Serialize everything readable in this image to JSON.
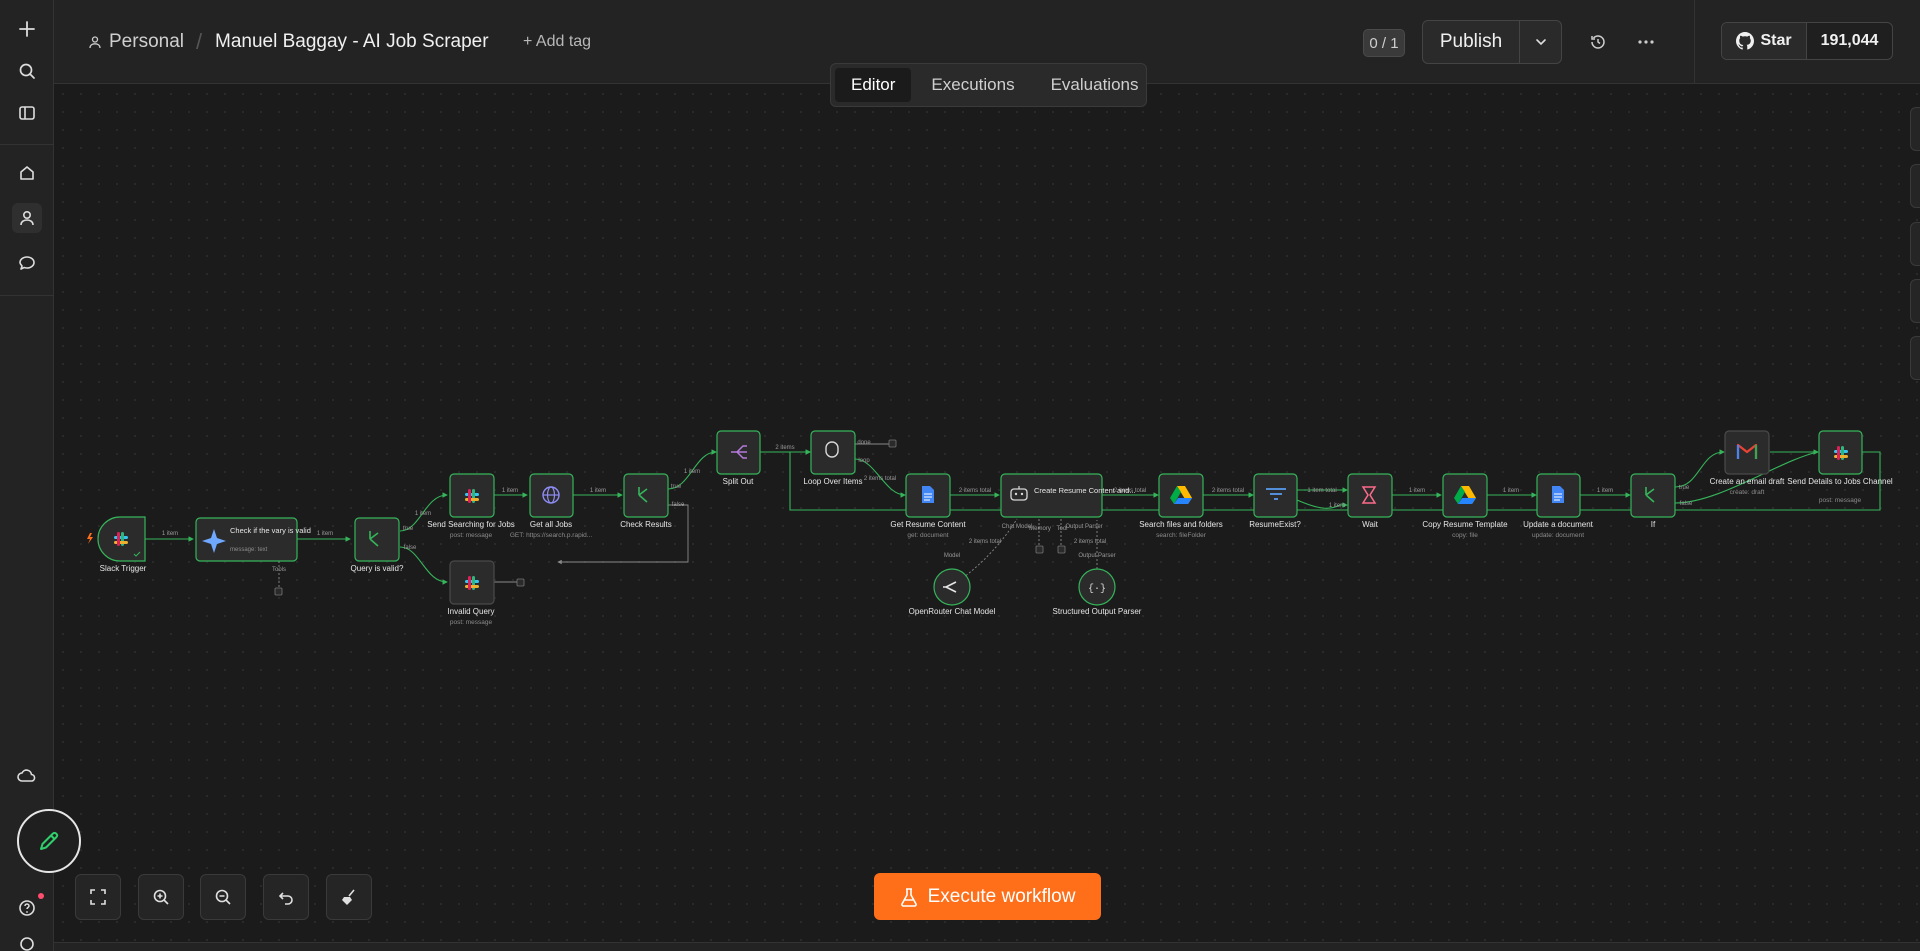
{
  "rail": {
    "items": [
      "plus-icon",
      "search-icon",
      "sidebar-icon",
      "home-icon",
      "person-icon",
      "chat-icon"
    ],
    "bottom_items": [
      "cloud-icon",
      "help-icon",
      "settings-icon"
    ]
  },
  "header": {
    "project": "Personal",
    "title": "Manuel Baggay - AI Job Scraper",
    "add_tag": "+ Add tag",
    "counter": "0 / 1",
    "publish": "Publish",
    "github_star": "Star",
    "github_count": "191,044"
  },
  "tabs": [
    {
      "label": "Editor",
      "active": true
    },
    {
      "label": "Executions",
      "active": false
    },
    {
      "label": "Evaluations",
      "active": false
    }
  ],
  "execute_label": "Execute workflow",
  "accent_color": "#ff6f1a",
  "nodes": [
    {
      "id": "slack-trigger",
      "label": "Slack Trigger",
      "sub": "",
      "icon": "slack"
    },
    {
      "id": "check-query",
      "label": "Check if the vary is valid",
      "sub": "message: text",
      "icon": "gemini"
    },
    {
      "id": "query-valid",
      "label": "Query is valid?",
      "sub": "",
      "icon": "if"
    },
    {
      "id": "send-searching",
      "label": "Send Searching for Jobs",
      "sub": "post: message",
      "icon": "slack"
    },
    {
      "id": "invalid-query",
      "label": "Invalid Query",
      "sub": "post: message",
      "icon": "slack"
    },
    {
      "id": "get-all-jobs",
      "label": "Get all Jobs",
      "sub": "GET: https://search.p.rapid...",
      "icon": "http"
    },
    {
      "id": "check-results",
      "label": "Check Results",
      "sub": "",
      "icon": "if"
    },
    {
      "id": "split-out",
      "label": "Split Out",
      "sub": "",
      "icon": "split"
    },
    {
      "id": "loop-items",
      "label": "Loop Over Items",
      "sub": "",
      "icon": "loop"
    },
    {
      "id": "get-resume",
      "label": "Get Resume Content",
      "sub": "get: document",
      "icon": "docs"
    },
    {
      "id": "create-resume",
      "label": "Create Resume Content and...",
      "sub": "",
      "icon": "agent"
    },
    {
      "id": "openrouter",
      "label": "OpenRouter Chat Model",
      "sub": "",
      "icon": "openrouter"
    },
    {
      "id": "structured-parser",
      "label": "Structured Output Parser",
      "sub": "",
      "icon": "parser"
    },
    {
      "id": "search-files",
      "label": "Search files and folders",
      "sub": "search: fileFolder",
      "icon": "drive"
    },
    {
      "id": "resume-exist",
      "label": "ResumeExist?",
      "sub": "",
      "icon": "filter"
    },
    {
      "id": "wait",
      "label": "Wait",
      "sub": "",
      "icon": "wait"
    },
    {
      "id": "copy-template",
      "label": "Copy Resume Template",
      "sub": "copy: file",
      "icon": "drive"
    },
    {
      "id": "update-doc",
      "label": "Update a document",
      "sub": "update: document",
      "icon": "docs"
    },
    {
      "id": "if",
      "label": "If",
      "sub": "",
      "icon": "if"
    },
    {
      "id": "email-draft",
      "label": "Create an email draft",
      "sub": "create: draft",
      "icon": "gmail"
    },
    {
      "id": "send-details",
      "label": "Send Details to Jobs Channel",
      "sub": "post: message",
      "icon": "slack"
    }
  ],
  "edge_labels": {
    "one_item": "1 item",
    "two_items": "2 items",
    "two_items_total": "2 items total",
    "one_item_total": "1 item total",
    "true": "true",
    "false": "false",
    "tools": "Tools",
    "done": "done",
    "loop": "loop",
    "model": "Model",
    "output_parser": "Output Parser",
    "chat_model": "Chat Model",
    "memory": "Memory",
    "tool": "Tool"
  }
}
